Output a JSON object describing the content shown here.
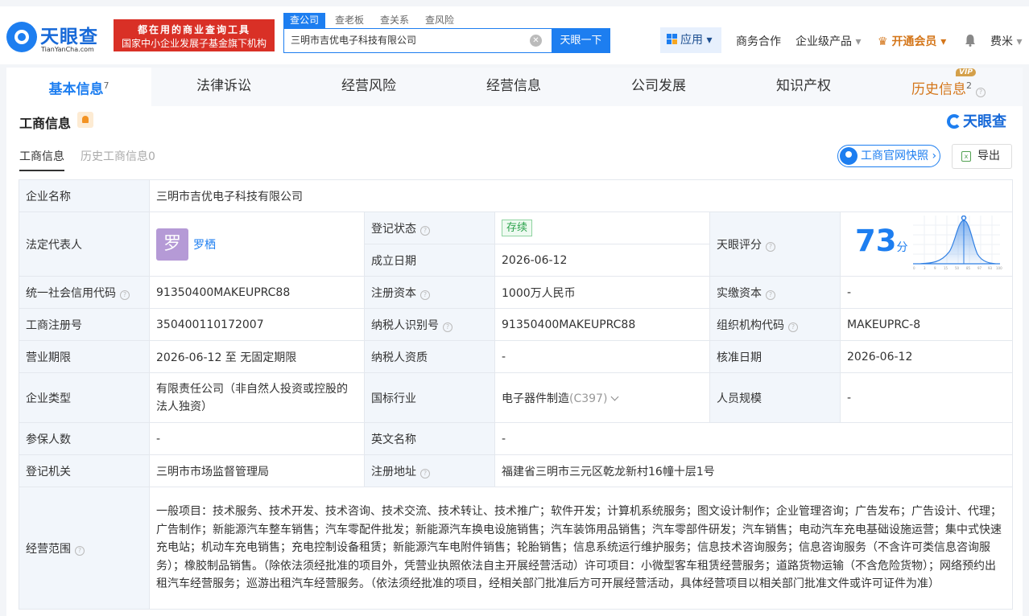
{
  "header": {
    "logo_name": "天眼查",
    "logo_sub": "TianYanCha.com",
    "banner_line1": "都在用的商业查询工具",
    "banner_line2": "国家中小企业发展子基金旗下机构",
    "search_tabs": [
      "查公司",
      "查老板",
      "查关系",
      "查风险"
    ],
    "search_value": "三明市吉优电子科技有限公司",
    "search_button": "天眼一下",
    "app_button": "应用",
    "nav_business": "商务合作",
    "nav_enterprise": "企业级产品",
    "nav_vip": "开通会员",
    "user": "费米"
  },
  "tabs": [
    {
      "label": "基本信息",
      "count": "7"
    },
    {
      "label": "法律诉讼",
      "count": ""
    },
    {
      "label": "经营风险",
      "count": ""
    },
    {
      "label": "经营信息",
      "count": ""
    },
    {
      "label": "公司发展",
      "count": ""
    },
    {
      "label": "知识产权",
      "count": ""
    },
    {
      "label": "历史信息",
      "count": "2"
    }
  ],
  "vip_badge": "VIP",
  "section": {
    "title": "工商信息",
    "brand": "天眼查",
    "subtab_active": "工商信息",
    "subtab_history": "历史工商信息0",
    "snapshot_button": "工商官网快照",
    "export_button": "导出"
  },
  "info": {
    "company_name_label": "企业名称",
    "company_name": "三明市吉优电子科技有限公司",
    "legal_rep_label": "法定代表人",
    "legal_rep_avatar": "罗",
    "legal_rep": "罗栖",
    "reg_status_label": "登记状态",
    "reg_status": "存续",
    "found_date_label": "成立日期",
    "found_date": "2026-06-12",
    "score_label": "天眼评分",
    "score": "73",
    "score_unit": "分",
    "score_ticks": [
      "0",
      "3",
      "9",
      "15",
      "50",
      "85",
      "97",
      "93",
      "100"
    ],
    "credit_code_label": "统一社会信用代码",
    "credit_code": "91350400MAKEUPRC88",
    "reg_capital_label": "注册资本",
    "reg_capital": "1000万人民币",
    "paid_capital_label": "实缴资本",
    "paid_capital": "-",
    "reg_no_label": "工商注册号",
    "reg_no": "350400110172007",
    "taxpayer_id_label": "纳税人识别号",
    "taxpayer_id": "91350400MAKEUPRC88",
    "org_code_label": "组织机构代码",
    "org_code": "MAKEUPRC-8",
    "term_label": "营业期限",
    "term": "2026-06-12 至 无固定期限",
    "taxpayer_qual_label": "纳税人资质",
    "taxpayer_qual": "-",
    "approve_date_label": "核准日期",
    "approve_date": "2026-06-12",
    "type_label": "企业类型",
    "type": "有限责任公司（非自然人投资或控股的法人独资）",
    "industry_label": "国标行业",
    "industry": "电子器件制造",
    "industry_code": "(C397)",
    "staff_label": "人员规模",
    "staff": "-",
    "insured_label": "参保人数",
    "insured": "-",
    "english_name_label": "英文名称",
    "english_name": "-",
    "authority_label": "登记机关",
    "authority": "三明市市场监督管理局",
    "address_label": "注册地址",
    "address": "福建省三明市三元区乾龙新村16幢十层1号",
    "scope_label": "经营范围",
    "scope": "一般项目：技术服务、技术开发、技术咨询、技术交流、技术转让、技术推广；软件开发；计算机系统服务；图文设计制作；企业管理咨询；广告发布；广告设计、代理；广告制作；新能源汽车整车销售；汽车零配件批发；新能源汽车换电设施销售；汽车装饰用品销售；汽车零部件研发；汽车销售；电动汽车充电基础设施运营；集中式快速充电站；机动车充电销售；充电控制设备租赁；新能源汽车电附件销售；轮胎销售；信息系统运行维护服务；信息技术咨询服务；信息咨询服务（不含许可类信息咨询服务）；橡胶制品销售。（除依法须经批准的项目外，凭营业执照依法自主开展经营活动）许可项目：小微型客车租赁经营服务；道路货物运输（不含危险货物）；网络预约出租汽车经营服务；巡游出租汽车经营服务。（依法须经批准的项目，经相关部门批准后方可开展经营活动，具体经营项目以相关部门批准文件或许可证件为准）"
  }
}
